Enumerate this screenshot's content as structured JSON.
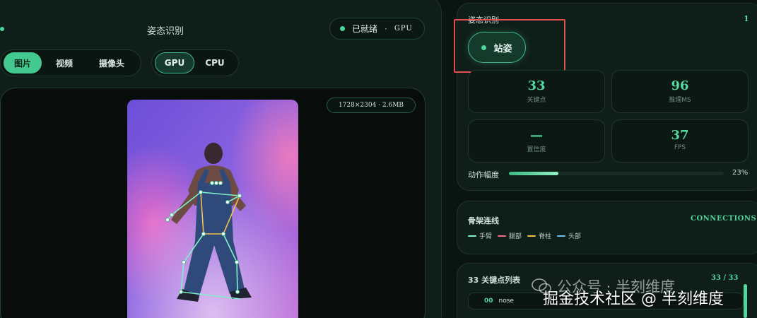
{
  "left_panel": {
    "title": "姿态识别",
    "status": {
      "label": "已就绪",
      "separator": "·",
      "device": "GPU"
    },
    "source_tabs": [
      {
        "label": "图片",
        "active": true
      },
      {
        "label": "视频",
        "active": false
      },
      {
        "label": "摄像头",
        "active": false
      }
    ],
    "device_tabs": [
      {
        "label": "GPU",
        "active": true
      },
      {
        "label": "CPU",
        "active": false
      }
    ],
    "image_meta": "1728×2304 · 2.6MB"
  },
  "status_card": {
    "title": "姿态识别",
    "count": "1",
    "pose_label": "站姿",
    "stats": [
      {
        "value": "33",
        "label": "关键点"
      },
      {
        "value": "96",
        "label": "推理MS"
      },
      {
        "value": "—",
        "label": "置信度"
      },
      {
        "value": "37",
        "label": "FPS"
      }
    ],
    "motion": {
      "label": "动作幅度",
      "percent_text": "23%",
      "value": 0.23
    }
  },
  "bones_card": {
    "title": "骨架连线",
    "tag": "CONNECTIONS",
    "legend": [
      {
        "label": "手臂",
        "color": "#7ff0c8"
      },
      {
        "label": "腿部",
        "color": "#ef6f8c"
      },
      {
        "label": "脊柱",
        "color": "#f0c04a"
      },
      {
        "label": "头部",
        "color": "#6fc3f0"
      }
    ]
  },
  "keypoints_card": {
    "title": "33 关键点列表",
    "count": "33 / 33",
    "rows": [
      {
        "index": "00",
        "name": "nose"
      }
    ]
  },
  "watermark": {
    "line1": "公众号 · 半刻维度",
    "line2": "掘金技术社区 @ 半刻维度"
  }
}
